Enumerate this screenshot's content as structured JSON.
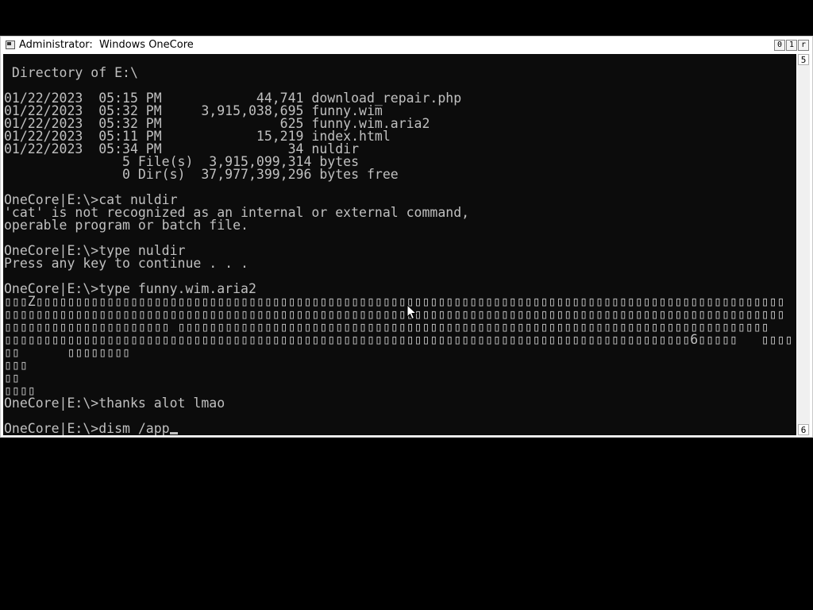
{
  "window": {
    "title": "Administrator:  Windows OneCore",
    "controls": {
      "minimize": "0",
      "maximize": "1",
      "close": "r"
    }
  },
  "scrollbar": {
    "up_glyph": "5",
    "down_glyph": "6"
  },
  "console": {
    "lines": [
      "",
      " Directory of E:\\",
      "",
      "01/22/2023  05:15 PM            44,741 download_repair.php",
      "01/22/2023  05:32 PM     3,915,038,695 funny.wim",
      "01/22/2023  05:32 PM               625 funny.wim.aria2",
      "01/22/2023  05:11 PM            15,219 index.html",
      "01/22/2023  05:34 PM                34 nuldir",
      "               5 File(s)  3,915,099,314 bytes",
      "               0 Dir(s)  37,977,399,296 bytes free",
      "",
      "OneCore|E:\\>cat nuldir",
      "'cat' is not recognized as an internal or external command,",
      "operable program or batch file.",
      "",
      "OneCore|E:\\>type nuldir",
      "Press any key to continue . . .",
      "",
      "OneCore|E:\\>type funny.wim.aria2",
      "▯▯▯Z▯▯▯▯▯▯▯▯▯▯▯▯▯▯▯▯▯▯▯▯▯▯▯▯▯▯▯▯▯▯▯▯▯▯▯▯▯▯▯▯▯▯▯▯▯▯▯▯▯▯▯▯▯▯▯▯▯▯▯▯▯▯▯▯▯▯▯▯▯▯▯▯▯▯▯▯▯▯▯▯▯▯▯▯▯▯▯▯▯▯▯▯▯▯▯",
      "▯▯▯▯▯▯▯▯▯▯▯▯▯▯▯▯▯▯▯▯▯▯▯▯▯▯▯▯▯▯▯▯▯▯▯▯▯▯▯▯▯▯▯▯▯▯▯▯▯▯▯▯▯▯▯▯▯▯▯▯▯▯▯▯▯▯▯▯▯▯▯▯▯▯▯▯▯▯▯▯▯▯▯▯▯▯▯▯▯▯▯▯▯▯▯▯▯▯▯",
      "▯▯▯▯▯▯▯▯▯▯▯▯▯▯▯▯▯▯▯▯▯ ▯▯▯▯▯▯▯▯▯▯▯▯▯▯▯▯▯▯▯▯▯▯▯▯▯▯▯▯▯▯▯▯▯▯▯▯▯▯▯▯▯▯▯▯▯▯▯▯▯▯▯▯▯▯▯▯▯▯▯▯▯▯▯▯▯▯▯▯▯▯▯▯▯▯▯",
      "▯▯▯▯▯▯▯▯▯▯▯▯▯▯▯▯▯▯▯▯▯▯▯▯▯▯▯▯▯▯▯▯▯▯▯▯▯▯▯▯▯▯▯▯▯▯▯▯▯▯▯▯▯▯▯▯▯▯▯▯▯▯▯▯▯▯▯▯▯▯▯▯▯▯▯▯▯▯▯▯▯▯▯▯▯▯▯6▯▯▯▯▯   ▯▯▯▯",
      "▯▯      ▯▯▯▯▯▯▯▯",
      "▯▯▯",
      "▯▯",
      "▯▯▯▯",
      "OneCore|E:\\>thanks alot lmao",
      "",
      "OneCore|E:\\>dism /app"
    ]
  }
}
